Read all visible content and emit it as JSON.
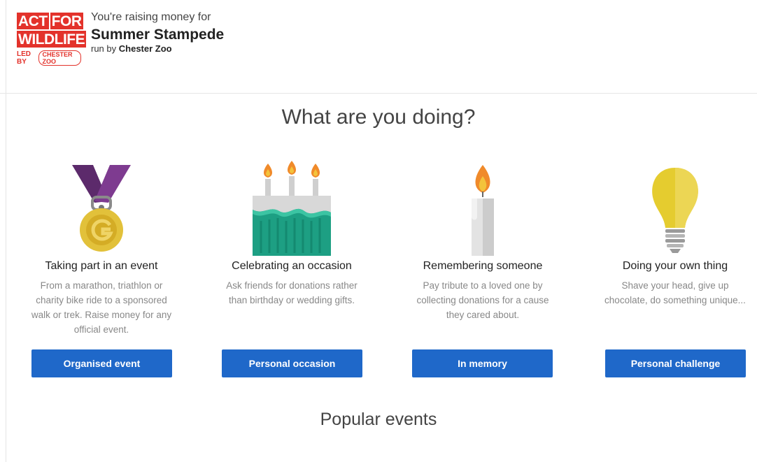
{
  "logo": {
    "line1": [
      "ACT",
      "FOR"
    ],
    "line2": "WILDLIFE",
    "led_by": "LED BY",
    "zoo_badge": "CHESTER ZOO"
  },
  "header": {
    "pre_text": "You're raising money for",
    "campaign_title": "Summer Stampede",
    "run_by_prefix": "run by",
    "organisation": "Chester Zoo"
  },
  "main": {
    "heading": "What are you doing?",
    "options": [
      {
        "icon": "medal-icon",
        "title": "Taking part in an event",
        "description": "From a marathon, triathlon or charity bike ride to a sponsored walk or trek. Raise money for any official event.",
        "button": "Organised event"
      },
      {
        "icon": "birthday-cake-icon",
        "title": "Celebrating an occasion",
        "description": "Ask friends for donations rather than birthday or wedding gifts.",
        "button": "Personal occasion"
      },
      {
        "icon": "candle-icon",
        "title": "Remembering someone",
        "description": "Pay tribute to a loved one by collecting donations for a cause they cared about.",
        "button": "In memory"
      },
      {
        "icon": "lightbulb-icon",
        "title": "Doing your own thing",
        "description": "Shave your head, give up chocolate, do something unique...",
        "button": "Personal challenge"
      }
    ],
    "popular_heading": "Popular events"
  },
  "colors": {
    "brand_red": "#e3322b",
    "button_blue": "#1f68c9"
  }
}
